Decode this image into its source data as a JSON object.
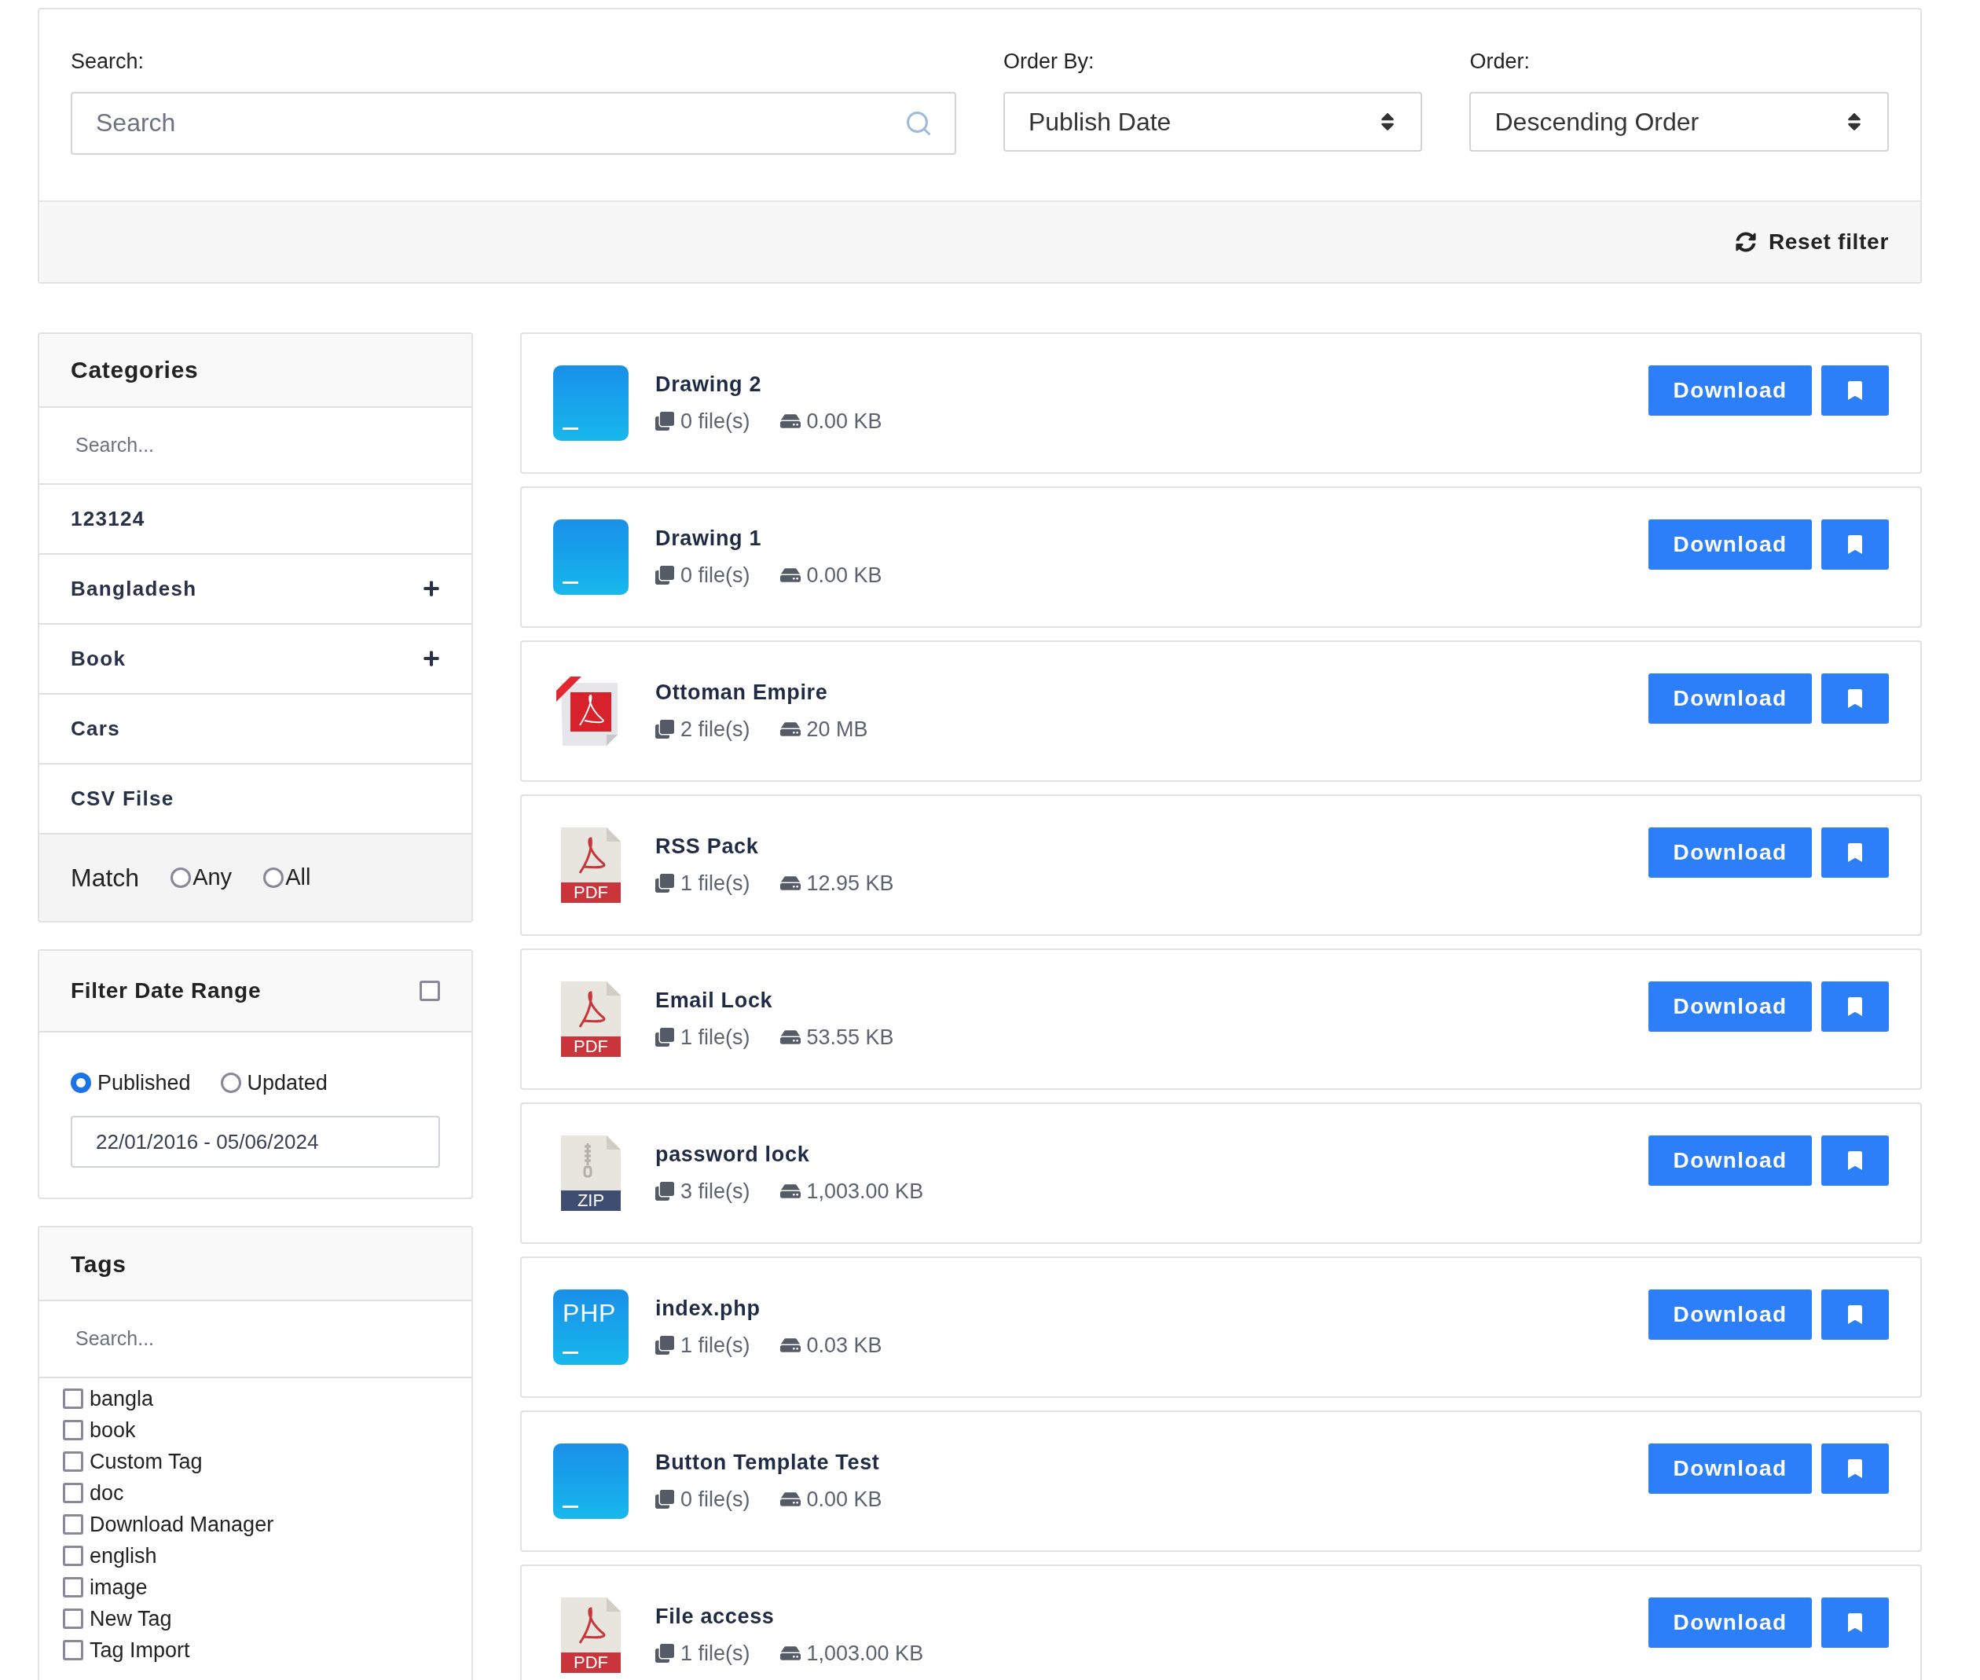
{
  "filters": {
    "search_label": "Search:",
    "search_placeholder": "Search",
    "order_by_label": "Order By:",
    "order_by_value": "Publish Date",
    "order_label": "Order:",
    "order_value": "Descending Order",
    "reset_label": "Reset filter"
  },
  "categories": {
    "title": "Categories",
    "search_placeholder": "Search...",
    "items": [
      {
        "label": "123124",
        "expandable": false
      },
      {
        "label": "Bangladesh",
        "expandable": true
      },
      {
        "label": "Book",
        "expandable": true
      },
      {
        "label": "Cars",
        "expandable": false
      },
      {
        "label": "CSV Filse",
        "expandable": false
      }
    ],
    "match_label": "Match",
    "match_options": [
      {
        "label": "Any",
        "selected": false
      },
      {
        "label": "All",
        "selected": false
      }
    ]
  },
  "date_range": {
    "title": "Filter Date Range",
    "checked": false,
    "options": [
      {
        "label": "Published",
        "selected": true
      },
      {
        "label": "Updated",
        "selected": false
      }
    ],
    "value": "22/01/2016 - 05/06/2024"
  },
  "tags": {
    "title": "Tags",
    "search_placeholder": "Search...",
    "items": [
      {
        "label": "bangla",
        "checked": false
      },
      {
        "label": "book",
        "checked": false
      },
      {
        "label": "Custom Tag",
        "checked": false
      },
      {
        "label": "doc",
        "checked": false
      },
      {
        "label": "Download Manager",
        "checked": false
      },
      {
        "label": "english",
        "checked": false
      },
      {
        "label": "image",
        "checked": false
      },
      {
        "label": "New Tag",
        "checked": false
      },
      {
        "label": "Tag Import",
        "checked": false
      }
    ]
  },
  "files": [
    {
      "title": "Drawing 2",
      "kind": "tile",
      "file_count": "0 file(s)",
      "size": "0.00 KB",
      "button": "Download"
    },
    {
      "title": "Drawing 1",
      "kind": "tile",
      "file_count": "0 file(s)",
      "size": "0.00 KB",
      "button": "Download"
    },
    {
      "title": "Ottoman Empire",
      "kind": "acrobat",
      "file_count": "2 file(s)",
      "size": "20 MB",
      "button": "Download"
    },
    {
      "title": "RSS Pack",
      "kind": "document",
      "badge": "PDF",
      "color": "#c9353a",
      "file_count": "1 file(s)",
      "size": "12.95 KB",
      "button": "Download"
    },
    {
      "title": "Email Lock",
      "kind": "document",
      "badge": "PDF",
      "color": "#c9353a",
      "file_count": "1 file(s)",
      "size": "53.55 KB",
      "button": "Download"
    },
    {
      "title": "password lock",
      "kind": "archive",
      "badge": "ZIP",
      "color": "#3f4d73",
      "file_count": "3 file(s)",
      "size": "1,003.00 KB",
      "button": "Download"
    },
    {
      "title": "index.php",
      "kind": "tile",
      "badge": "PHP",
      "file_count": "1 file(s)",
      "size": "0.03 KB",
      "button": "Download"
    },
    {
      "title": "Button Template Test",
      "kind": "tile",
      "file_count": "0 file(s)",
      "size": "0.00 KB",
      "button": "Download"
    },
    {
      "title": "File access",
      "kind": "document",
      "badge": "PDF",
      "color": "#c9353a",
      "file_count": "1 file(s)",
      "size": "1,003.00 KB",
      "button": "Download"
    }
  ]
}
